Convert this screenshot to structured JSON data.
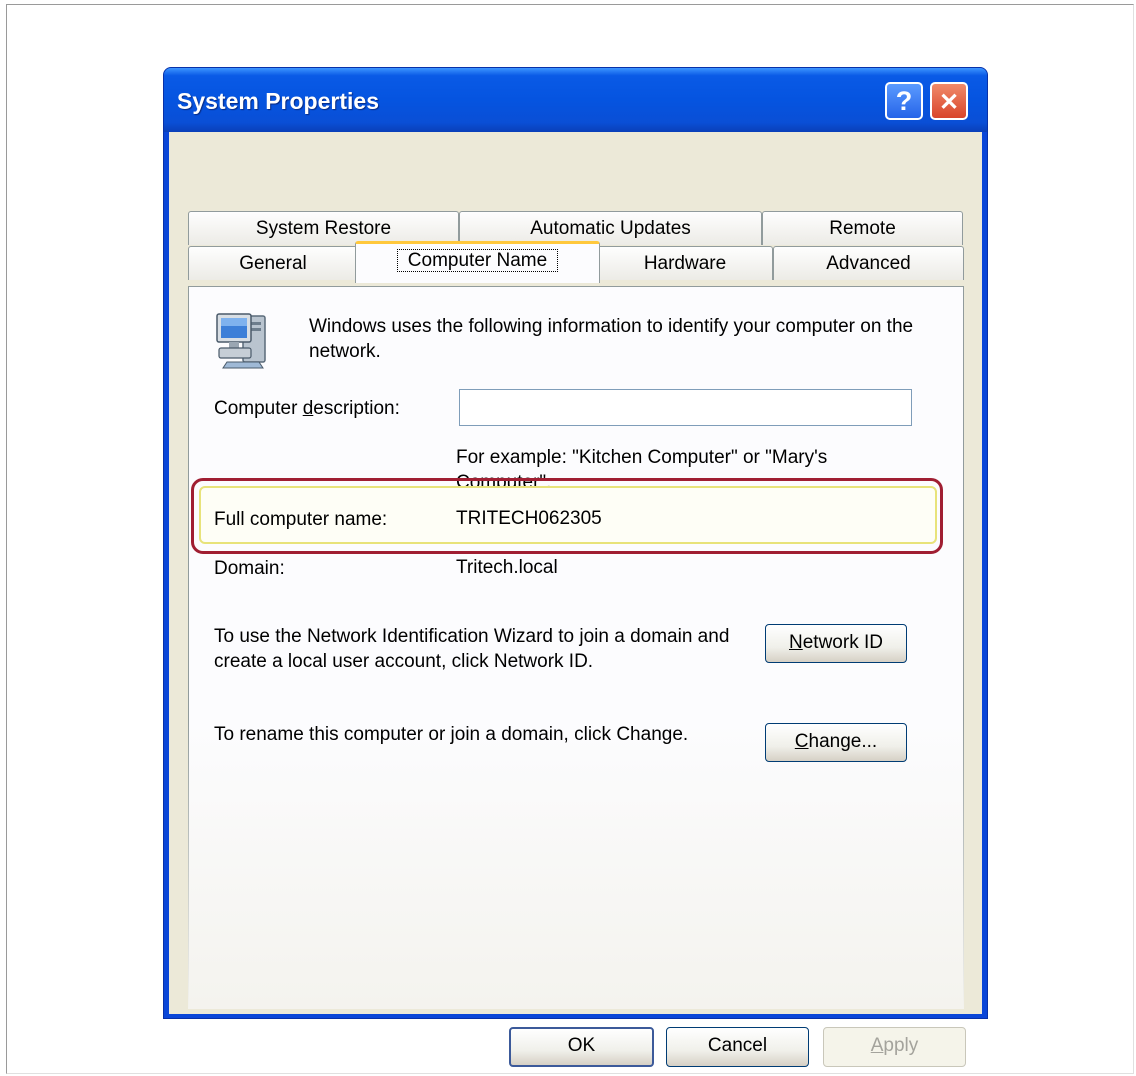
{
  "window": {
    "title": "System Properties",
    "help_glyph": "?",
    "close_glyph": "✕"
  },
  "tabs_back": [
    {
      "label": "System Restore"
    },
    {
      "label": "Automatic Updates"
    },
    {
      "label": "Remote"
    }
  ],
  "tabs_front": [
    {
      "label": "General"
    },
    {
      "label": "Computer Name",
      "active": true
    },
    {
      "label": "Hardware"
    },
    {
      "label": "Advanced"
    }
  ],
  "panel": {
    "intro": "Windows uses the following information to identify your computer on the network.",
    "description_label_pre": "Computer ",
    "description_label_hotkey": "d",
    "description_label_post": "escription:",
    "description_value": "",
    "description_example": "For example: \"Kitchen Computer\" or \"Mary's Computer\".",
    "full_name_label": "Full computer name:",
    "full_name_value": "TRITECH062305",
    "domain_label": "Domain:",
    "domain_value": "Tritech.local",
    "network_id_text": "To use the Network Identification Wizard to join a domain and create a local user account, click Network ID.",
    "network_id_button_hotkey": "N",
    "network_id_button_rest": "etwork ID",
    "change_text": "To rename this computer or join a domain, click Change.",
    "change_button_hotkey": "C",
    "change_button_rest": "hange..."
  },
  "footer": {
    "ok_label": "OK",
    "cancel_label": "Cancel",
    "apply_hotkey": "A",
    "apply_rest": "pply"
  },
  "icons": {
    "computer": "computer-network-icon",
    "help": "help-icon",
    "close": "close-icon"
  },
  "colors": {
    "titlebar": "#0554e0",
    "highlight_outer": "#a01e32",
    "highlight_inner": "#e8e37a",
    "tab_active_accent": "#ffc83c"
  }
}
